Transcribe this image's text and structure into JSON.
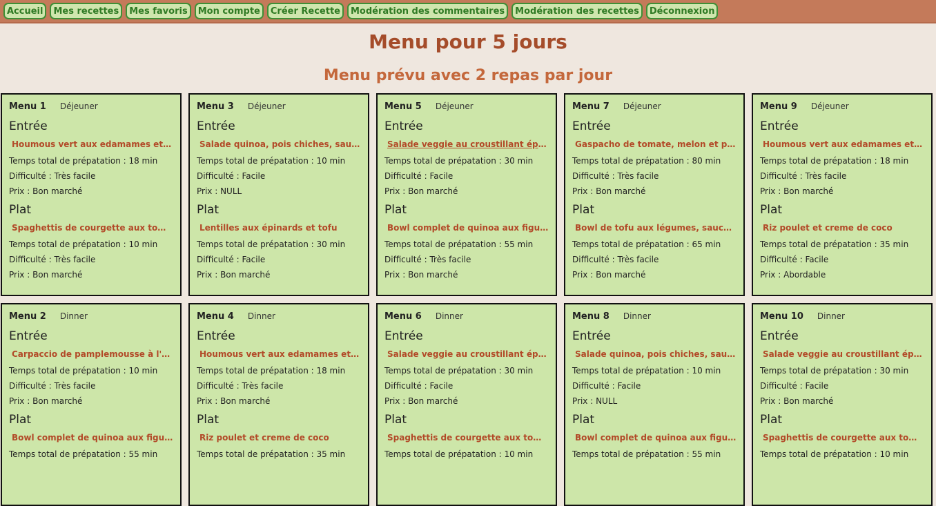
{
  "nav": {
    "items": [
      "Accueil",
      "Mes recettes",
      "Mes favoris",
      "Mon compte",
      "Créer Recette",
      "Modération des commentaires",
      "Modération des recettes",
      "Déconnexion"
    ]
  },
  "page": {
    "title": "Menu pour 5 jours",
    "subtitle": "Menu prévu avec 2 repas par jour"
  },
  "labels": {
    "entree": "Entrée",
    "plat": "Plat"
  },
  "colors": {
    "navbar": "#c47a5a",
    "nav_button_bg": "#cfe6ad",
    "card_bg": "#cde6a9",
    "title": "#a54c2a",
    "recipe_link": "#b24a28"
  },
  "menus": [
    {
      "name": "Menu 1",
      "meal": "Déjeuner",
      "entree": {
        "recipe": "Houmous vert aux edamames et avocat",
        "time": "Temps total de prépatation : 18 min",
        "difficulty": "Difficulté : Très facile",
        "price": "Prix : Bon marché"
      },
      "plat": {
        "recipe": "Spaghettis de courgette aux tomates c...",
        "time": "Temps total de prépatation : 10 min",
        "difficulty": "Difficulté : Très facile",
        "price": "Prix : Bon marché"
      }
    },
    {
      "name": "Menu 3",
      "meal": "Déjeuner",
      "entree": {
        "recipe": "Salade quinoa, pois chiches, sauce cru...",
        "time": "Temps total de prépatation : 10 min",
        "difficulty": "Difficulté : Facile",
        "price": "Prix : NULL"
      },
      "plat": {
        "recipe": "Lentilles aux épinards et tofu",
        "time": "Temps total de prépatation : 30 min",
        "difficulty": "Difficulté : Facile",
        "price": "Prix : Bon marché"
      }
    },
    {
      "name": "Menu 5",
      "meal": "Déjeuner",
      "entree": {
        "recipe": "Salade veggie au croustillant épinard",
        "time": "Temps total de prépatation : 30 min",
        "difficulty": "Difficulté : Facile",
        "price": "Prix : Bon marché"
      },
      "plat": {
        "recipe": "Bowl complet de quinoa aux figues, fe...",
        "time": "Temps total de prépatation : 55 min",
        "difficulty": "Difficulté : Très facile",
        "price": "Prix : Bon marché"
      }
    },
    {
      "name": "Menu 7",
      "meal": "Déjeuner",
      "entree": {
        "recipe": "Gaspacho de tomate, melon et pastèq...",
        "time": "Temps total de prépatation : 80 min",
        "difficulty": "Difficulté : Très facile",
        "price": "Prix : Bon marché"
      },
      "plat": {
        "recipe": "Bowl de tofu aux légumes, sauce au m...",
        "time": "Temps total de prépatation : 65 min",
        "difficulty": "Difficulté : Très facile",
        "price": "Prix : Bon marché"
      }
    },
    {
      "name": "Menu 9",
      "meal": "Déjeuner",
      "entree": {
        "recipe": "Houmous vert aux edamames et avocat",
        "time": "Temps total de prépatation : 18 min",
        "difficulty": "Difficulté : Très facile",
        "price": "Prix : Bon marché"
      },
      "plat": {
        "recipe": "Riz poulet et creme de coco",
        "time": "Temps total de prépatation : 35 min",
        "difficulty": "Difficulté : Facile",
        "price": "Prix : Abordable"
      }
    },
    {
      "name": "Menu 2",
      "meal": "Dinner",
      "entree": {
        "recipe": "Carpaccio de pamplemousse à l'huile ...",
        "time": "Temps total de prépatation : 10 min",
        "difficulty": "Difficulté : Très facile",
        "price": "Prix : Bon marché"
      },
      "plat": {
        "recipe": "Bowl complet de quinoa aux figues, fe...",
        "time": "Temps total de prépatation : 55 min",
        "difficulty": "",
        "price": ""
      }
    },
    {
      "name": "Menu 4",
      "meal": "Dinner",
      "entree": {
        "recipe": "Houmous vert aux edamames et avocat",
        "time": "Temps total de prépatation : 18 min",
        "difficulty": "Difficulté : Très facile",
        "price": "Prix : Bon marché"
      },
      "plat": {
        "recipe": "Riz poulet et creme de coco",
        "time": "Temps total de prépatation : 35 min",
        "difficulty": "",
        "price": ""
      }
    },
    {
      "name": "Menu 6",
      "meal": "Dinner",
      "entree": {
        "recipe": "Salade veggie au croustillant épinard",
        "time": "Temps total de prépatation : 30 min",
        "difficulty": "Difficulté : Facile",
        "price": "Prix : Bon marché"
      },
      "plat": {
        "recipe": "Spaghettis de courgette aux tomates c...",
        "time": "Temps total de prépatation : 10 min",
        "difficulty": "",
        "price": ""
      }
    },
    {
      "name": "Menu 8",
      "meal": "Dinner",
      "entree": {
        "recipe": "Salade quinoa, pois chiches, sauce cru...",
        "time": "Temps total de prépatation : 10 min",
        "difficulty": "Difficulté : Facile",
        "price": "Prix : NULL"
      },
      "plat": {
        "recipe": "Bowl complet de quinoa aux figues, fe...",
        "time": "Temps total de prépatation : 55 min",
        "difficulty": "",
        "price": ""
      }
    },
    {
      "name": "Menu 10",
      "meal": "Dinner",
      "entree": {
        "recipe": "Salade veggie au croustillant épinard",
        "time": "Temps total de prépatation : 30 min",
        "difficulty": "Difficulté : Facile",
        "price": "Prix : Bon marché"
      },
      "plat": {
        "recipe": "Spaghettis de courgette aux tomates c...",
        "time": "Temps total de prépatation : 10 min",
        "difficulty": "",
        "price": ""
      }
    }
  ]
}
